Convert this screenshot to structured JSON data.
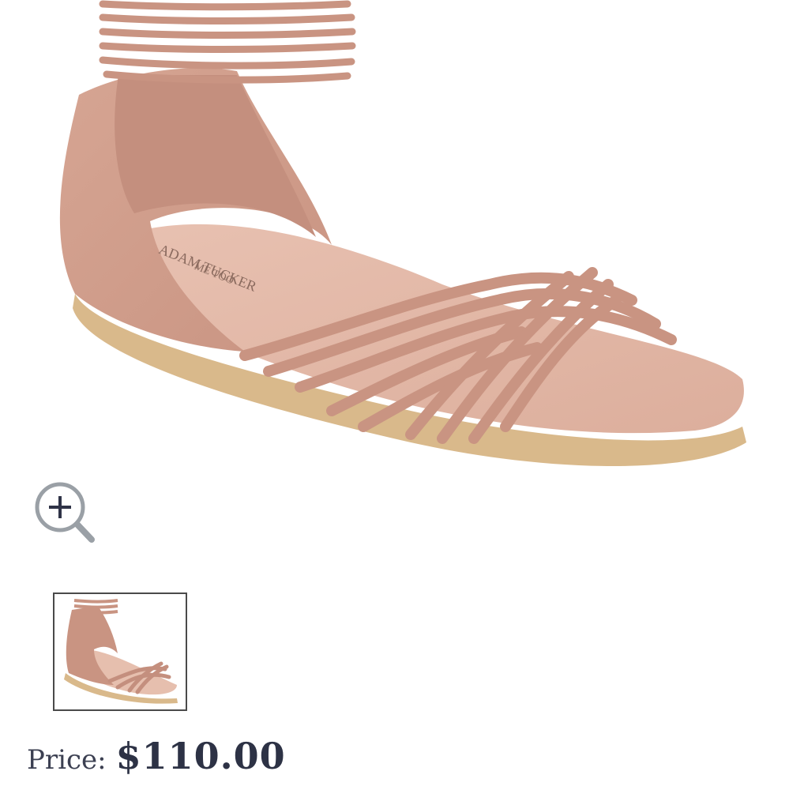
{
  "product": {
    "image_alt": "Pink nubuck ankle-strap sandal with twisted cord toe straps",
    "insole_brand": "ADAM TUCKER",
    "insole_sub": "ME TOO",
    "main_color": "#d8a898",
    "sole_color": "#d9b98b"
  },
  "zoom": {
    "icon": "zoom-in-icon"
  },
  "thumbnails": [
    {
      "label": "sandal thumbnail",
      "selected": true
    }
  ],
  "price": {
    "label": "Price:",
    "value": "$110.00"
  }
}
